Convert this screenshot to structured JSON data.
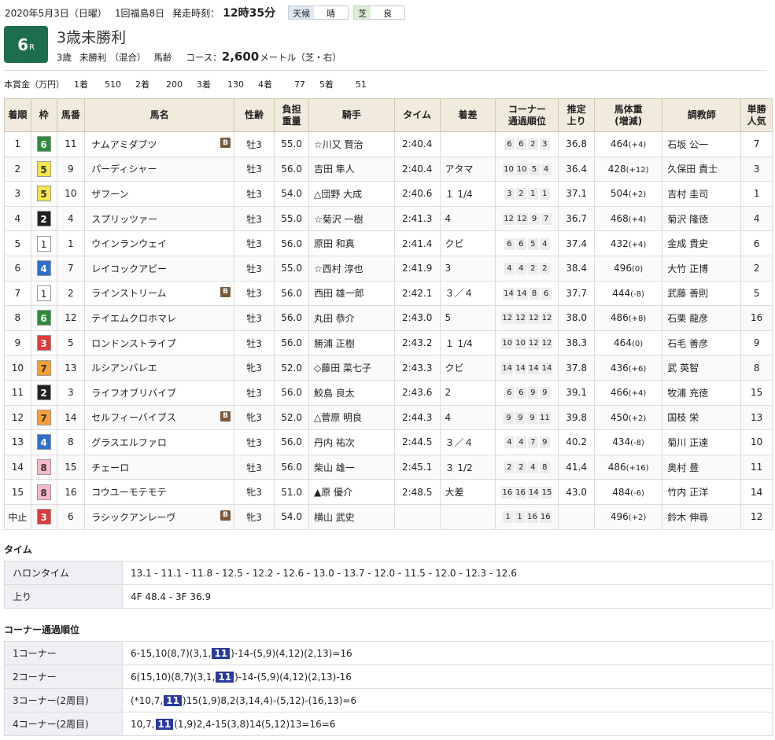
{
  "header": {
    "date": "2020年5月3日（日曜）",
    "meeting": "1回福島8日",
    "start_label": "発走時刻：",
    "start_time": "12時35分",
    "weather_label": "天候",
    "weather": "晴",
    "track_label": "芝",
    "track_cond": "良"
  },
  "race": {
    "number": "6",
    "r": "R",
    "title": "3歳未勝利",
    "age": "3歳",
    "class": "未勝利",
    "mixed": "（混合）",
    "weight_rule": "馬齢",
    "course_label": "コース：",
    "distance": "2,600",
    "unit": "メートル（芝・右）"
  },
  "prize": {
    "label": "本賞金（万円）",
    "items": [
      {
        "place": "1着",
        "amount": "510"
      },
      {
        "place": "2着",
        "amount": "200"
      },
      {
        "place": "3着",
        "amount": "130"
      },
      {
        "place": "4着",
        "amount": "77"
      },
      {
        "place": "5着",
        "amount": "51"
      }
    ]
  },
  "table": {
    "headers": [
      "着順",
      "枠",
      "馬番",
      "馬名",
      "性齢",
      "負担\n重量",
      "騎手",
      "タイム",
      "着差",
      "コーナー\n通過順位",
      "推定\n上り",
      "馬体重\n(増減)",
      "調教師",
      "単勝\n人気"
    ],
    "blinker": "B",
    "rows": [
      {
        "pos": "1",
        "waku": "6",
        "num": "11",
        "name": "ナムアミダブツ",
        "b": true,
        "sex": "牡3",
        "wt": "55.0",
        "jockey": "☆川又 賢治",
        "time": "2:40.4",
        "margin": "",
        "c": [
          "6",
          "6",
          "2",
          "3"
        ],
        "up": "36.8",
        "bw": "464",
        "bd": "(+4)",
        "trainer": "石坂 公一",
        "pop": "7"
      },
      {
        "pos": "2",
        "waku": "5",
        "num": "9",
        "name": "パーディシャー",
        "b": false,
        "sex": "牡3",
        "wt": "56.0",
        "jockey": "吉田 隼人",
        "time": "2:40.4",
        "margin": "アタマ",
        "c": [
          "10",
          "10",
          "5",
          "4"
        ],
        "up": "36.4",
        "bw": "428",
        "bd": "(+12)",
        "trainer": "久保田 貴士",
        "pop": "3"
      },
      {
        "pos": "3",
        "waku": "5",
        "num": "10",
        "name": "ザフーン",
        "b": false,
        "sex": "牡3",
        "wt": "54.0",
        "jockey": "△団野 大成",
        "time": "2:40.6",
        "margin": "１ 1/4",
        "c": [
          "3",
          "2",
          "1",
          "1"
        ],
        "up": "37.1",
        "bw": "504",
        "bd": "(+2)",
        "trainer": "吉村 圭司",
        "pop": "1"
      },
      {
        "pos": "4",
        "waku": "2",
        "num": "4",
        "name": "スプリッツァー",
        "b": false,
        "sex": "牡3",
        "wt": "55.0",
        "jockey": "☆菊沢 一樹",
        "time": "2:41.3",
        "margin": "4",
        "c": [
          "12",
          "12",
          "9",
          "7"
        ],
        "up": "36.7",
        "bw": "468",
        "bd": "(+4)",
        "trainer": "菊沢 隆徳",
        "pop": "4"
      },
      {
        "pos": "5",
        "waku": "1",
        "num": "1",
        "name": "ウインランウェイ",
        "b": false,
        "sex": "牡3",
        "wt": "56.0",
        "jockey": "原田 和真",
        "time": "2:41.4",
        "margin": "クビ",
        "c": [
          "6",
          "6",
          "5",
          "4"
        ],
        "up": "37.4",
        "bw": "432",
        "bd": "(+4)",
        "trainer": "金成 貴史",
        "pop": "6"
      },
      {
        "pos": "6",
        "waku": "4",
        "num": "7",
        "name": "レイコックアビー",
        "b": false,
        "sex": "牡3",
        "wt": "55.0",
        "jockey": "☆西村 淳也",
        "time": "2:41.9",
        "margin": "3",
        "c": [
          "4",
          "4",
          "2",
          "2"
        ],
        "up": "38.4",
        "bw": "496",
        "bd": "(0)",
        "trainer": "大竹 正博",
        "pop": "2"
      },
      {
        "pos": "7",
        "waku": "1",
        "num": "2",
        "name": "ラインストリーム",
        "b": true,
        "sex": "牡3",
        "wt": "56.0",
        "jockey": "西田 雄一郎",
        "time": "2:42.1",
        "margin": "３／４",
        "c": [
          "14",
          "14",
          "8",
          "6"
        ],
        "up": "37.7",
        "bw": "444",
        "bd": "(-8)",
        "trainer": "武藤 善則",
        "pop": "5"
      },
      {
        "pos": "8",
        "waku": "6",
        "num": "12",
        "name": "テイエムクロホマレ",
        "b": false,
        "sex": "牡3",
        "wt": "56.0",
        "jockey": "丸田 恭介",
        "time": "2:43.0",
        "margin": "5",
        "c": [
          "12",
          "12",
          "12",
          "12"
        ],
        "up": "38.0",
        "bw": "486",
        "bd": "(+8)",
        "trainer": "石栗 龍彦",
        "pop": "16"
      },
      {
        "pos": "9",
        "waku": "3",
        "num": "5",
        "name": "ロンドンストライプ",
        "b": false,
        "sex": "牡3",
        "wt": "56.0",
        "jockey": "勝浦 正樹",
        "time": "2:43.2",
        "margin": "１ 1/4",
        "c": [
          "10",
          "10",
          "12",
          "12"
        ],
        "up": "38.3",
        "bw": "464",
        "bd": "(0)",
        "trainer": "石毛 善彦",
        "pop": "9"
      },
      {
        "pos": "10",
        "waku": "7",
        "num": "13",
        "name": "ルシアンバレエ",
        "b": false,
        "sex": "牝3",
        "wt": "52.0",
        "jockey": "◇藤田 菜七子",
        "time": "2:43.3",
        "margin": "クビ",
        "c": [
          "14",
          "14",
          "14",
          "14"
        ],
        "up": "37.8",
        "bw": "436",
        "bd": "(+6)",
        "trainer": "武 英智",
        "pop": "8"
      },
      {
        "pos": "11",
        "waku": "2",
        "num": "3",
        "name": "ライフオブリバイブ",
        "b": false,
        "sex": "牡3",
        "wt": "56.0",
        "jockey": "鮫島 良太",
        "time": "2:43.6",
        "margin": "2",
        "c": [
          "6",
          "6",
          "9",
          "9"
        ],
        "up": "39.1",
        "bw": "466",
        "bd": "(+4)",
        "trainer": "牧浦 充徳",
        "pop": "15"
      },
      {
        "pos": "12",
        "waku": "7",
        "num": "14",
        "name": "セルフィーバイブス",
        "b": true,
        "sex": "牝3",
        "wt": "52.0",
        "jockey": "△菅原 明良",
        "time": "2:44.3",
        "margin": "4",
        "c": [
          "9",
          "9",
          "9",
          "11"
        ],
        "up": "39.8",
        "bw": "450",
        "bd": "(+2)",
        "trainer": "国枝 栄",
        "pop": "13"
      },
      {
        "pos": "13",
        "waku": "4",
        "num": "8",
        "name": "グラスエルファロ",
        "b": false,
        "sex": "牡3",
        "wt": "56.0",
        "jockey": "丹内 祐次",
        "time": "2:44.5",
        "margin": "３／４",
        "c": [
          "4",
          "4",
          "7",
          "9"
        ],
        "up": "40.2",
        "bw": "434",
        "bd": "(-8)",
        "trainer": "菊川 正達",
        "pop": "10"
      },
      {
        "pos": "14",
        "waku": "8",
        "num": "15",
        "name": "チェーロ",
        "b": false,
        "sex": "牡3",
        "wt": "56.0",
        "jockey": "柴山 雄一",
        "time": "2:45.1",
        "margin": "３ 1/2",
        "c": [
          "2",
          "2",
          "4",
          "8"
        ],
        "up": "41.4",
        "bw": "486",
        "bd": "(+16)",
        "trainer": "奥村 豊",
        "pop": "11"
      },
      {
        "pos": "15",
        "waku": "8",
        "num": "16",
        "name": "コウユーモテモテ",
        "b": false,
        "sex": "牝3",
        "wt": "51.0",
        "jockey": "▲原 優介",
        "time": "2:48.5",
        "margin": "大差",
        "c": [
          "16",
          "16",
          "14",
          "15"
        ],
        "up": "43.0",
        "bw": "484",
        "bd": "(-6)",
        "trainer": "竹内 正洋",
        "pop": "14"
      },
      {
        "pos": "中止",
        "waku": "3",
        "num": "6",
        "name": "ラシックアンレーヴ",
        "b": true,
        "sex": "牝3",
        "wt": "54.0",
        "jockey": "横山 武史",
        "time": "",
        "margin": "",
        "c": [
          "1",
          "1",
          "16",
          "16"
        ],
        "up": "",
        "bw": "496",
        "bd": "(+2)",
        "trainer": "鈴木 伸尋",
        "pop": "12"
      }
    ]
  },
  "time_section": {
    "title": "タイム",
    "rows": [
      {
        "label": "ハロンタイム",
        "value": "13.1 - 11.1 - 11.8 - 12.5 - 12.2 - 12.6 - 13.0 - 13.7 - 12.0 - 11.5 - 12.0 - 12.3 - 12.6"
      },
      {
        "label": "上り",
        "value": "4F 48.4 - 3F 36.9"
      }
    ]
  },
  "corner_section": {
    "title": "コーナー通過順位",
    "highlight": "11",
    "rows": [
      {
        "label": "1コーナー",
        "before": "6-15,10(8,7)(3,1,",
        "after": ")-14-(5,9)(4,12)(2,13)=16"
      },
      {
        "label": "2コーナー",
        "before": "6(15,10)(8,7)(3,1,",
        "after": ")-14-(5,9)(4,12)(2,13)-16"
      },
      {
        "label": "3コーナー(2周目)",
        "before": "(*10,7,",
        "after": ")15(1,9)8,2(3,14,4)-(5,12)-(16,13)=6"
      },
      {
        "label": "4コーナー(2周目)",
        "before": "10,7,",
        "after": "(1,9)2,4-15(3,8)14(5,12)13=16=6"
      }
    ]
  }
}
